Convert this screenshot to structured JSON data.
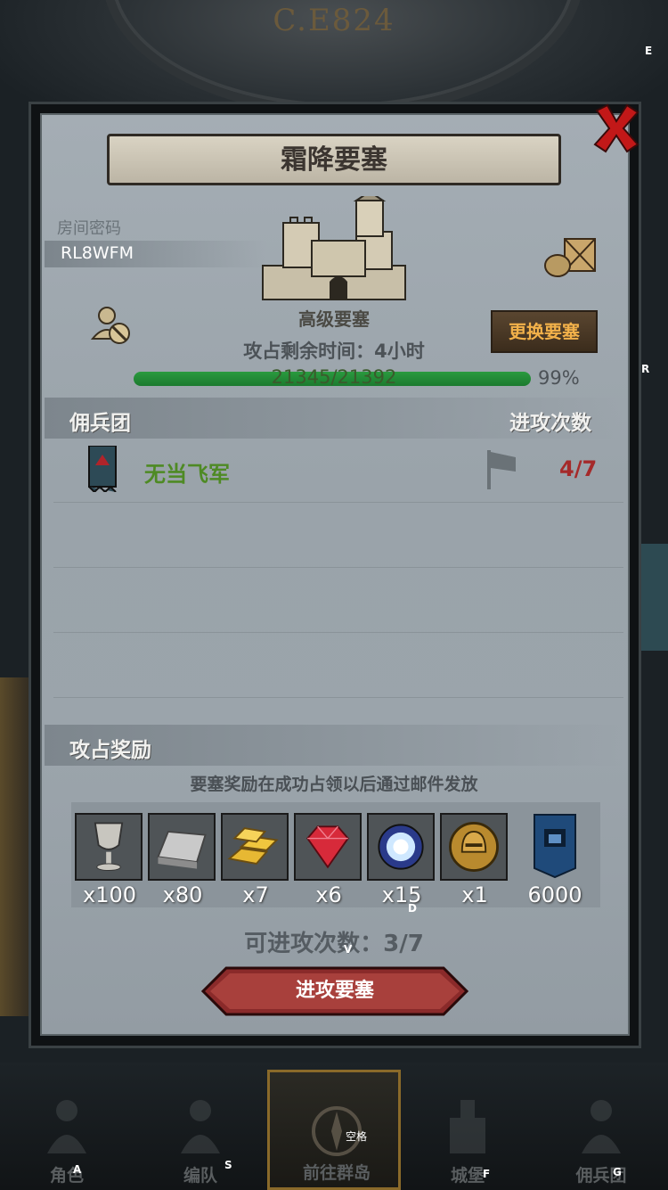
{
  "header": {
    "era": "C.E824"
  },
  "dialog": {
    "title": "霜降要塞",
    "room_label": "房间密码",
    "room_code": "RL8WFM",
    "fortress_name": "高级要塞",
    "remaining_time": "攻占剩余时间：4小时",
    "change_button": "更换要塞",
    "progress": {
      "text": "21345/21392",
      "percent": "99%",
      "fraction": 0.99
    },
    "section_mercenary": {
      "title": "佣兵团",
      "count_header": "进攻次数"
    },
    "team": {
      "name": "无当飞军",
      "attacks": "4/7"
    },
    "section_rewards": {
      "title": "攻占奖励",
      "note": "要塞奖励在成功占领以后通过邮件发放"
    },
    "rewards": [
      {
        "icon": "goblet-icon",
        "qty": "x100"
      },
      {
        "icon": "iron-ingot-icon",
        "qty": "x80"
      },
      {
        "icon": "gold-bars-icon",
        "qty": "x7"
      },
      {
        "icon": "ruby-icon",
        "qty": "x6"
      },
      {
        "icon": "crystal-orb-icon",
        "qty": "x15"
      },
      {
        "icon": "helmet-medal-icon",
        "qty": "x1"
      },
      {
        "icon": "guild-token-icon",
        "qty": "6000"
      }
    ],
    "attempts": "可进攻次数：3/7",
    "attack_button": "进攻要塞"
  },
  "nav": [
    {
      "label": "角色",
      "key": "A"
    },
    {
      "label": "编队",
      "key": "S"
    },
    {
      "label": "前往群岛",
      "key": "空格"
    },
    {
      "label": "城堡",
      "key": "F"
    },
    {
      "label": "佣兵团",
      "key": "G"
    }
  ],
  "hotkeys": {
    "e": "E",
    "r": "R",
    "d": "D",
    "v": "V"
  },
  "colors": {
    "accent": "#f2b14a",
    "progress": "#2a9a3f",
    "team": "#4e8a24",
    "count": "#a52a2a",
    "close": "#c21818"
  }
}
